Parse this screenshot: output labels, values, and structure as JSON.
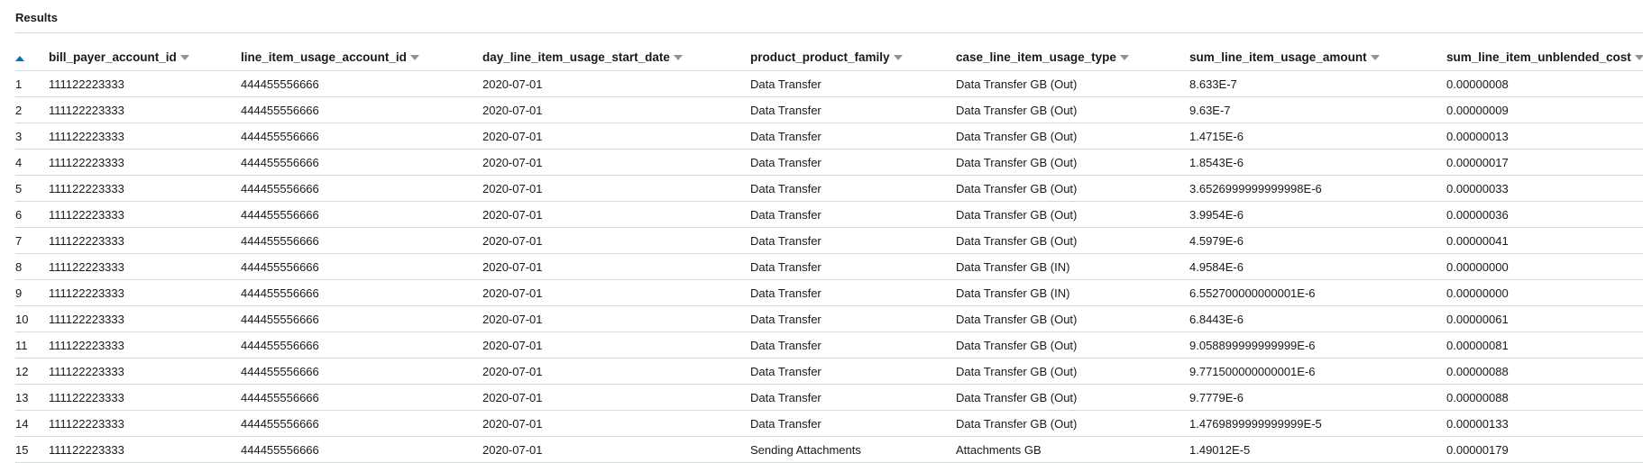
{
  "panel": {
    "title": "Results"
  },
  "table": {
    "columns": [
      "bill_payer_account_id",
      "line_item_usage_account_id",
      "day_line_item_usage_start_date",
      "product_product_family",
      "case_line_item_usage_type",
      "sum_line_item_usage_amount",
      "sum_line_item_unblended_cost"
    ],
    "rows": [
      [
        "1",
        "111122223333",
        "444455556666",
        "2020-07-01",
        "Data Transfer",
        "Data Transfer GB (Out)",
        "8.633E-7",
        "0.00000008"
      ],
      [
        "2",
        "111122223333",
        "444455556666",
        "2020-07-01",
        "Data Transfer",
        "Data Transfer GB (Out)",
        "9.63E-7",
        "0.00000009"
      ],
      [
        "3",
        "111122223333",
        "444455556666",
        "2020-07-01",
        "Data Transfer",
        "Data Transfer GB (Out)",
        "1.4715E-6",
        "0.00000013"
      ],
      [
        "4",
        "111122223333",
        "444455556666",
        "2020-07-01",
        "Data Transfer",
        "Data Transfer GB (Out)",
        "1.8543E-6",
        "0.00000017"
      ],
      [
        "5",
        "111122223333",
        "444455556666",
        "2020-07-01",
        "Data Transfer",
        "Data Transfer GB (Out)",
        "3.6526999999999998E-6",
        "0.00000033"
      ],
      [
        "6",
        "111122223333",
        "444455556666",
        "2020-07-01",
        "Data Transfer",
        "Data Transfer GB (Out)",
        "3.9954E-6",
        "0.00000036"
      ],
      [
        "7",
        "111122223333",
        "444455556666",
        "2020-07-01",
        "Data Transfer",
        "Data Transfer GB (Out)",
        "4.5979E-6",
        "0.00000041"
      ],
      [
        "8",
        "111122223333",
        "444455556666",
        "2020-07-01",
        "Data Transfer",
        "Data Transfer GB (IN)",
        "4.9584E-6",
        "0.00000000"
      ],
      [
        "9",
        "111122223333",
        "444455556666",
        "2020-07-01",
        "Data Transfer",
        "Data Transfer GB (IN)",
        "6.552700000000001E-6",
        "0.00000000"
      ],
      [
        "10",
        "111122223333",
        "444455556666",
        "2020-07-01",
        "Data Transfer",
        "Data Transfer GB (Out)",
        "6.8443E-6",
        "0.00000061"
      ],
      [
        "11",
        "111122223333",
        "444455556666",
        "2020-07-01",
        "Data Transfer",
        "Data Transfer GB (Out)",
        "9.058899999999999E-6",
        "0.00000081"
      ],
      [
        "12",
        "111122223333",
        "444455556666",
        "2020-07-01",
        "Data Transfer",
        "Data Transfer GB (Out)",
        "9.771500000000001E-6",
        "0.00000088"
      ],
      [
        "13",
        "111122223333",
        "444455556666",
        "2020-07-01",
        "Data Transfer",
        "Data Transfer GB (Out)",
        "9.7779E-6",
        "0.00000088"
      ],
      [
        "14",
        "111122223333",
        "444455556666",
        "2020-07-01",
        "Data Transfer",
        "Data Transfer GB (Out)",
        "1.4769899999999999E-5",
        "0.00000133"
      ],
      [
        "15",
        "111122223333",
        "444455556666",
        "2020-07-01",
        "Sending Attachments",
        "Attachments GB",
        "1.49012E-5",
        "0.00000179"
      ]
    ]
  },
  "icons": {
    "row_number_sort": "sort-ascending-icon",
    "column_sort": "caret-down-icon"
  },
  "colors": {
    "sort_active": "#0073bb",
    "sort_inactive": "#879596",
    "divider": "#d5dbdb"
  }
}
